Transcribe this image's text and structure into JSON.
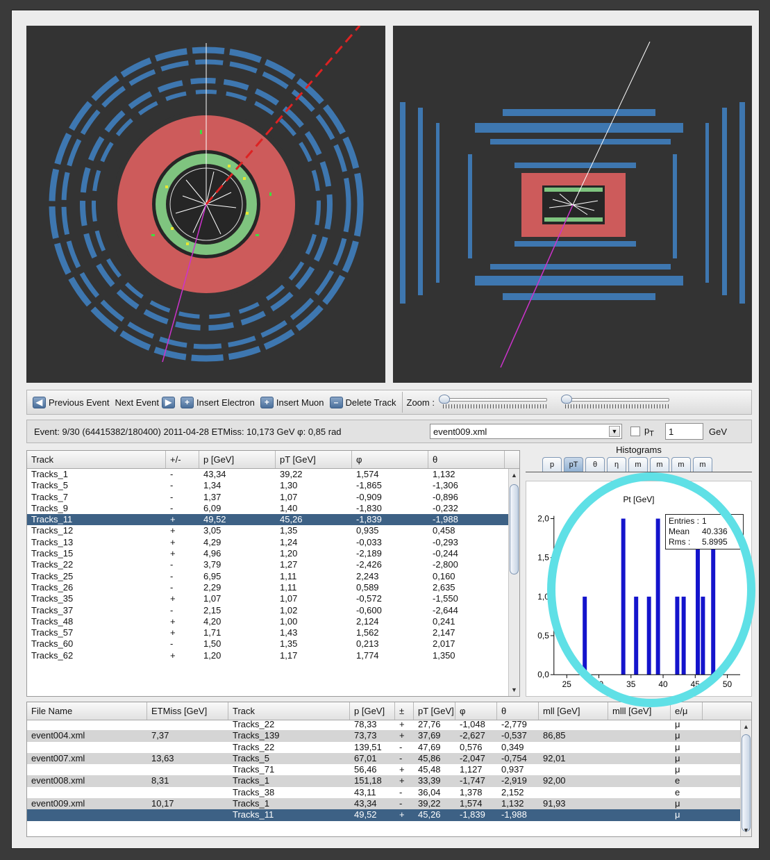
{
  "toolbar": {
    "previous_event": "Previous Event",
    "next_event": "Next Event",
    "insert_electron": "Insert Electron",
    "insert_muon": "Insert Muon",
    "delete_track": "Delete Track",
    "zoom_label": "Zoom :"
  },
  "eventbar": {
    "info": "Event: 9/30 (64415382/180400)  2011-04-28   ETMiss: 10,173 GeV   φ: 0,85 rad",
    "selected_file": "event009.xml",
    "pt_label": "p",
    "pt_sub": "T",
    "gev_value": "1",
    "gev_unit": "GeV"
  },
  "tracks_table": {
    "headers": [
      "Track",
      "+/-",
      "p [GeV]",
      "pT [GeV]",
      "φ",
      "θ"
    ],
    "rows": [
      [
        "Tracks_1",
        "-",
        "43,34",
        "39,22",
        "1,574",
        "1,132"
      ],
      [
        "Tracks_5",
        "-",
        "1,34",
        "1,30",
        "-1,865",
        "-1,306"
      ],
      [
        "Tracks_7",
        "-",
        "1,37",
        "1,07",
        "-0,909",
        "-0,896"
      ],
      [
        "Tracks_9",
        "-",
        "6,09",
        "1,40",
        "-1,830",
        "-0,232"
      ],
      [
        "Tracks_11",
        "+",
        "49,52",
        "45,26",
        "-1,839",
        "-1,988"
      ],
      [
        "Tracks_12",
        "+",
        "3,05",
        "1,35",
        "0,935",
        "0,458"
      ],
      [
        "Tracks_13",
        "+",
        "4,29",
        "1,24",
        "-0,033",
        "-0,293"
      ],
      [
        "Tracks_15",
        "+",
        "4,96",
        "1,20",
        "-2,189",
        "-0,244"
      ],
      [
        "Tracks_22",
        "-",
        "3,79",
        "1,27",
        "-2,426",
        "-2,800"
      ],
      [
        "Tracks_25",
        "-",
        "6,95",
        "1,11",
        "2,243",
        "0,160"
      ],
      [
        "Tracks_26",
        "-",
        "2,29",
        "1,11",
        "0,589",
        "2,635"
      ],
      [
        "Tracks_35",
        "+",
        "1,07",
        "1,07",
        "-0,572",
        "-1,550"
      ],
      [
        "Tracks_37",
        "-",
        "2,15",
        "1,02",
        "-0,600",
        "-2,644"
      ],
      [
        "Tracks_48",
        "+",
        "4,20",
        "1,00",
        "2,124",
        "0,241"
      ],
      [
        "Tracks_57",
        "+",
        "1,71",
        "1,43",
        "1,562",
        "2,147"
      ],
      [
        "Tracks_60",
        "-",
        "1,50",
        "1,35",
        "0,213",
        "2,017"
      ],
      [
        "Tracks_62",
        "+",
        "1,20",
        "1,17",
        "1,774",
        "1,350"
      ]
    ]
  },
  "histogram": {
    "title": "Histograms",
    "tabs": [
      "p",
      "pT",
      "θ",
      "η",
      "m",
      "m",
      "m",
      "m"
    ],
    "plot_title": "Pt [GeV]",
    "stats": {
      "entries_label": "Entries :",
      "entries": "1",
      "mean_label": "Mean",
      "mean": "40.336",
      "rms_label": "Rms :",
      "rms": "5.8995"
    }
  },
  "chart_data": {
    "type": "bar",
    "title": "Pt [GeV]",
    "x_ticks": [
      "25",
      "30",
      "35",
      "40",
      "45",
      "50"
    ],
    "y_ticks": [
      "0,0",
      "0,5",
      "1,0",
      "1,5",
      "2,0"
    ],
    "xlim": [
      23,
      52
    ],
    "ylim": [
      0,
      2.3
    ],
    "bars": [
      {
        "x": 27.8,
        "y": 1
      },
      {
        "x": 33.8,
        "y": 2
      },
      {
        "x": 35.8,
        "y": 1
      },
      {
        "x": 37.8,
        "y": 1
      },
      {
        "x": 39.2,
        "y": 2
      },
      {
        "x": 42.2,
        "y": 1
      },
      {
        "x": 43.2,
        "y": 1
      },
      {
        "x": 45.4,
        "y": 2
      },
      {
        "x": 46.2,
        "y": 1
      },
      {
        "x": 47.8,
        "y": 2
      }
    ],
    "bar_color": "#1414cc"
  },
  "files_table": {
    "headers": [
      "File Name",
      "ETMiss [GeV]",
      "Track",
      "p [GeV]",
      "±",
      "pT [GeV]",
      "φ",
      "θ",
      "mll [GeV]",
      "mlll [GeV]",
      "e/μ"
    ],
    "rows": [
      [
        "",
        "",
        "Tracks_22",
        "78,33",
        "+",
        "27,76",
        "-1,048",
        "-2,779",
        "",
        "",
        "μ"
      ],
      [
        "event004.xml",
        "7,37",
        "Tracks_139",
        "73,73",
        "+",
        "37,69",
        "-2,627",
        "-0,537",
        "86,85",
        "",
        "μ"
      ],
      [
        "",
        "",
        "Tracks_22",
        "139,51",
        "-",
        "47,69",
        "0,576",
        "0,349",
        "",
        "",
        "μ"
      ],
      [
        "event007.xml",
        "13,63",
        "Tracks_5",
        "67,01",
        "-",
        "45,86",
        "-2,047",
        "-0,754",
        "92,01",
        "",
        "μ"
      ],
      [
        "",
        "",
        "Tracks_71",
        "56,46",
        "+",
        "45,48",
        "1,127",
        "0,937",
        "",
        "",
        "μ"
      ],
      [
        "event008.xml",
        "8,31",
        "Tracks_1",
        "151,18",
        "+",
        "33,39",
        "-1,747",
        "-2,919",
        "92,00",
        "",
        "e"
      ],
      [
        "",
        "",
        "Tracks_38",
        "43,11",
        "-",
        "36,04",
        "1,378",
        "2,152",
        "",
        "",
        "e"
      ],
      [
        "event009.xml",
        "10,17",
        "Tracks_1",
        "43,34",
        "-",
        "39,22",
        "1,574",
        "1,132",
        "91,93",
        "",
        "μ"
      ],
      [
        "",
        "",
        "Tracks_11",
        "49,52",
        "+",
        "45,26",
        "-1,839",
        "-1,988",
        "",
        "",
        "μ"
      ]
    ]
  },
  "colors": {
    "selection": "#3d6185",
    "calorimeter_red": "#cd5b5b",
    "tracker_green": "#7fc47f",
    "muon_blue": "#3e77b0",
    "highlight_ring": "#5fe0e6"
  }
}
